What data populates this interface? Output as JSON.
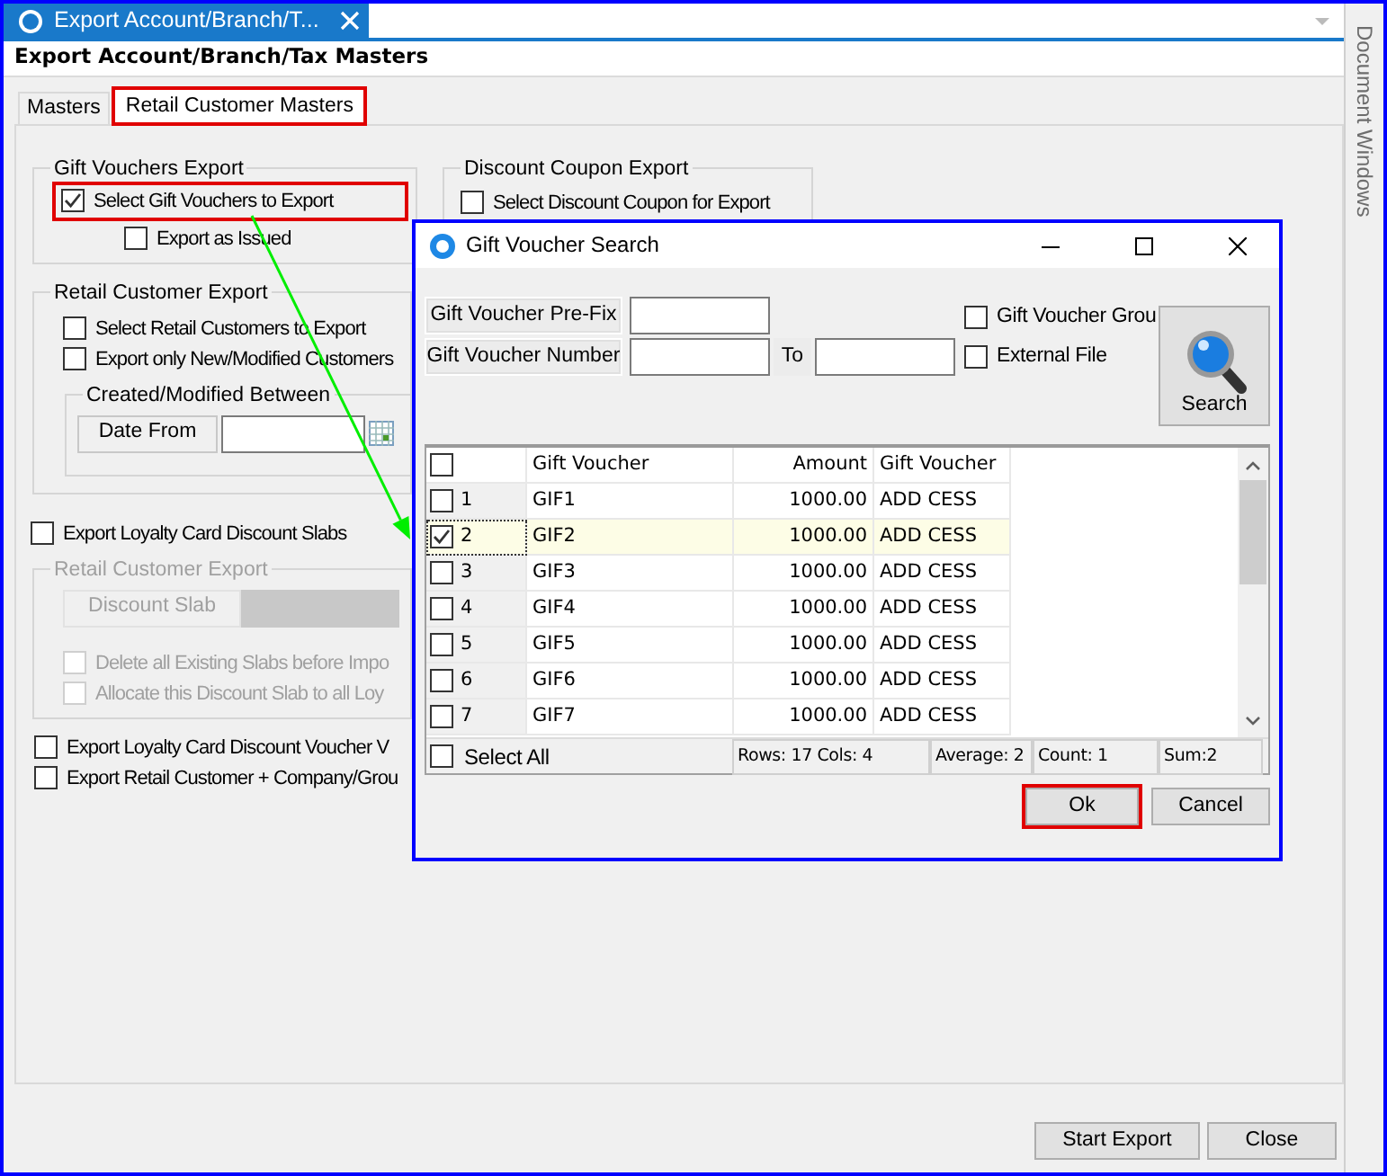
{
  "document_tab": {
    "title": "Export Account/Branch/T..."
  },
  "heading": "Export Account/Branch/Tax Masters",
  "side_panel": {
    "title": "Document Windows"
  },
  "tabs": [
    {
      "label": "Masters",
      "selected": false,
      "highlighted": false
    },
    {
      "label": "Retail Customer Masters",
      "selected": true,
      "highlighted": true
    }
  ],
  "gift_vouchers_export": {
    "legend": "Gift Vouchers Export",
    "options": [
      {
        "label": "Select Gift Vouchers to Export",
        "checked": true,
        "highlighted": true,
        "children": [
          {
            "label": "Export as Issued",
            "checked": false,
            "highlighted": false
          }
        ]
      }
    ]
  },
  "discount_coupon_export": {
    "legend": "Discount Coupon Export",
    "options": [
      {
        "label": "Select Discount Coupon for Export",
        "checked": false
      }
    ]
  },
  "retail_customer_export": {
    "legend": "Retail Customer Export",
    "options": [
      {
        "label": "Select Retail Customers to Export",
        "checked": false
      },
      {
        "label": "Export only New/Modified Customers",
        "checked": false
      }
    ],
    "date_range": {
      "legend": "Created/Modified Between",
      "label": "Date From"
    }
  },
  "loyalty_slabs": {
    "label": "Export Loyalty Card Discount Slabs",
    "checked": false
  },
  "slab_group": {
    "legend": "Retail Customer Export",
    "disabled": true,
    "tab": "Discount Slab",
    "options": [
      {
        "label": "Delete all Existing Slabs before Impo",
        "checked": false
      },
      {
        "label": "Allocate this Discount Slab to  all Loy",
        "checked": false
      }
    ]
  },
  "bottom_options": [
    {
      "label": "Export Loyalty Card Discount Voucher V",
      "checked": false
    },
    {
      "label": "Export Retail Customer + Company/Grou",
      "checked": false
    }
  ],
  "actions": [
    "Start Export",
    "Close"
  ],
  "dialog": {
    "title": "Gift Voucher Search",
    "prefix_label": "Gift Voucher Pre-Fix",
    "number_label": "Gift Voucher Number",
    "to_label": "To",
    "options": [
      {
        "label": "Gift Voucher Grou",
        "checked": false
      },
      {
        "label": "External File",
        "checked": false
      }
    ],
    "search_button": "Search",
    "grid": {
      "header_checked": false,
      "columns": [
        "Gift Voucher",
        "Amount",
        "Gift Voucher"
      ],
      "rows": [
        {
          "number": "1",
          "cells": [
            "GIF1",
            "1000.00",
            "ADD CESS"
          ],
          "checked": false,
          "selected": false
        },
        {
          "number": "2",
          "cells": [
            "GIF2",
            "1000.00",
            "ADD CESS"
          ],
          "checked": true,
          "selected": true
        },
        {
          "number": "3",
          "cells": [
            "GIF3",
            "1000.00",
            "ADD CESS"
          ],
          "checked": false,
          "selected": false
        },
        {
          "number": "4",
          "cells": [
            "GIF4",
            "1000.00",
            "ADD CESS"
          ],
          "checked": false,
          "selected": false
        },
        {
          "number": "5",
          "cells": [
            "GIF5",
            "1000.00",
            "ADD CESS"
          ],
          "checked": false,
          "selected": false
        },
        {
          "number": "6",
          "cells": [
            "GIF6",
            "1000.00",
            "ADD CESS"
          ],
          "checked": false,
          "selected": false
        },
        {
          "number": "7",
          "cells": [
            "GIF7",
            "1000.00",
            "ADD CESS"
          ],
          "checked": false,
          "selected": false
        }
      ],
      "select_all": {
        "label": "Select All",
        "checked": false
      },
      "status": [
        "Rows: 17  Cols: 4",
        "Average: 2",
        "Count: 1",
        "Sum:2"
      ]
    },
    "buttons": [
      {
        "label": "Ok",
        "highlighted": true
      },
      {
        "label": "Cancel",
        "highlighted": false
      }
    ]
  }
}
